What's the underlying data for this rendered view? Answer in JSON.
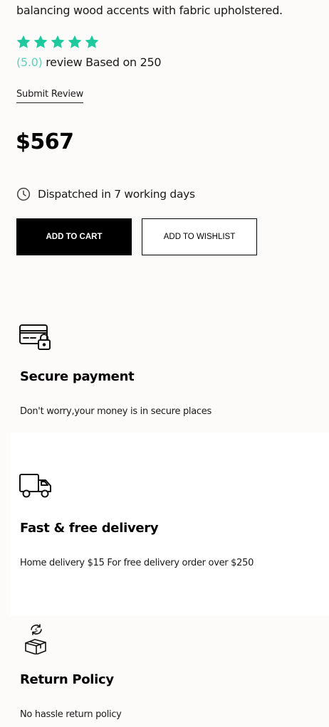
{
  "product": {
    "description_tail": "balancing wood accents with fabric upholstered.",
    "rating": {
      "stars": 5,
      "score_label": "(5.0)",
      "review_text": "review Based on 250",
      "star_color": "#1ec99e"
    },
    "submit_review_label": "Submit Review",
    "price": "$567",
    "dispatch": {
      "icon": "clock-icon",
      "text": "Dispatched in 7 working days"
    },
    "buttons": {
      "add_to_cart": "ADD TO CART",
      "add_to_wishlist": "ADD TO WISHLIST"
    }
  },
  "features": [
    {
      "icon": "secure-card-lock-icon",
      "title": "Secure payment",
      "text": "Don't worry,your money is in secure places"
    },
    {
      "icon": "delivery-truck-icon",
      "title": "Fast & free delivery",
      "text": "Home delivery $15 For free delivery order over $250"
    },
    {
      "icon": "return-box-icon",
      "title": "Return Policy",
      "text": "No hassle return policy"
    }
  ]
}
